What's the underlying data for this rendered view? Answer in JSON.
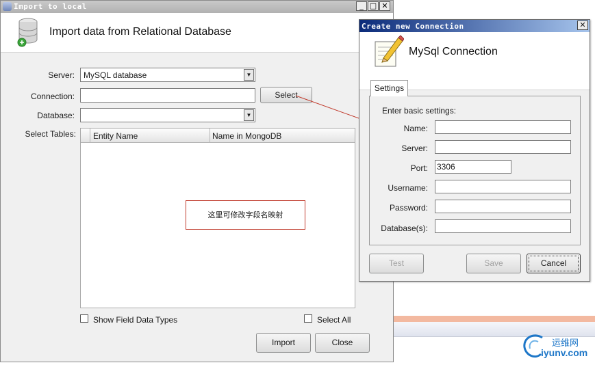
{
  "import_window": {
    "title": "Import to local",
    "caption_buttons": {
      "minimize": "_",
      "maximize": "□",
      "close": "✕"
    },
    "heading": "Import data from Relational Database",
    "server_label": "Server:",
    "server_value": "MySQL database",
    "connection_label": "Connection:",
    "connection_value": "",
    "select_button": "Select",
    "database_label": "Database:",
    "database_value": "",
    "tables_label": "Select Tables:",
    "columns": [
      "Entity Name",
      "Name in MongoDB"
    ],
    "note": "这里可修改字段名映射",
    "show_types_label": "Show Field Data Types",
    "select_all_label": "Select All",
    "import_button": "Import",
    "close_button": "Close"
  },
  "connection_dialog": {
    "title": "Create new Connection",
    "close": "✕",
    "heading": "MySql Connection",
    "tab": "Settings",
    "intro": "Enter basic settings:",
    "fields": [
      {
        "label": "Name:",
        "value": ""
      },
      {
        "label": "Server:",
        "value": ""
      },
      {
        "label": "Port:",
        "value": "3306"
      },
      {
        "label": "Username:",
        "value": ""
      },
      {
        "label": "Password:",
        "value": ""
      },
      {
        "label": "Database(s):",
        "value": ""
      }
    ],
    "test_button": "Test",
    "save_button": "Save",
    "cancel_button": "Cancel"
  },
  "watermark": {
    "cn": "运维网",
    "en": "iyunv.com"
  },
  "colors": {
    "annotation": "#c0392b",
    "dialog_title": "#0b2b7a",
    "watermark": "#1e77c8"
  }
}
